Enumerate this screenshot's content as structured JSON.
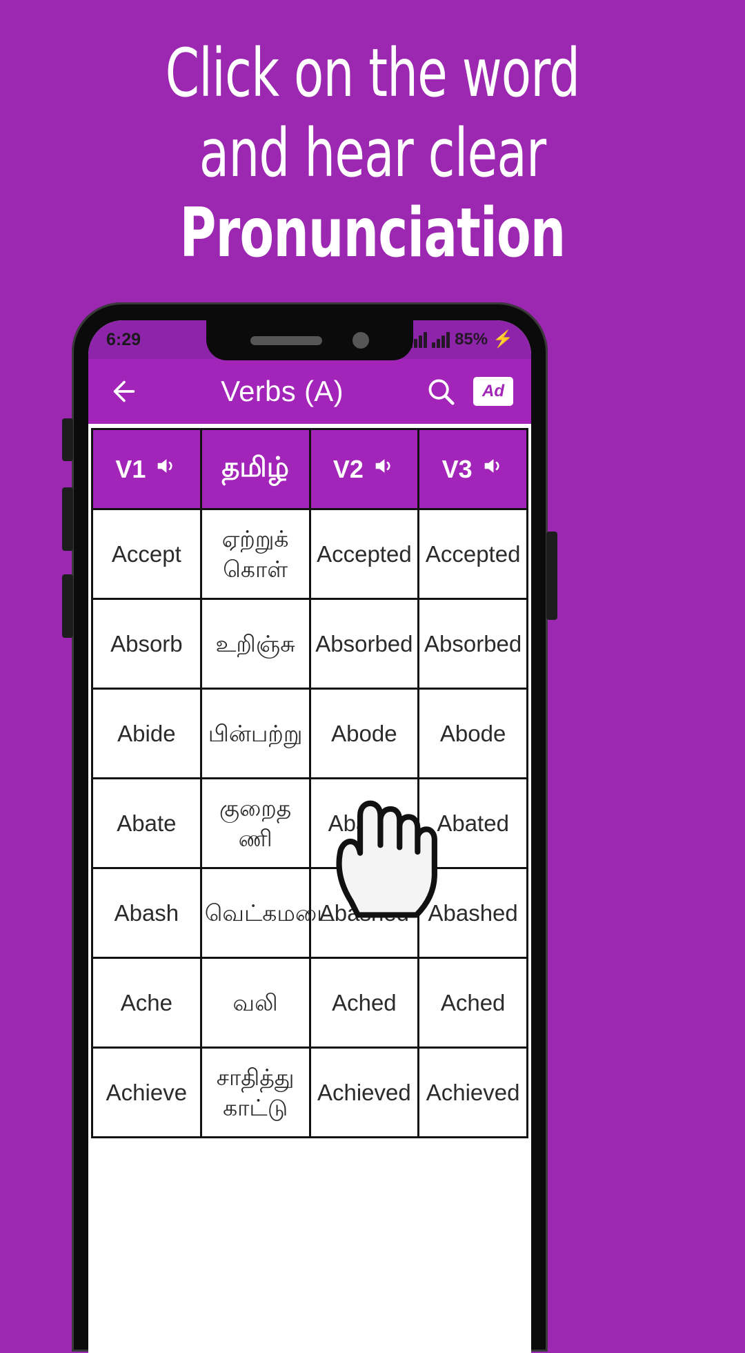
{
  "promo": {
    "lines": [
      "Click on the word",
      "and hear clear",
      "Pronunciation"
    ],
    "background_color": "#9C27B0",
    "text_color": "#FFFFFF"
  },
  "phone": {
    "status_bar": {
      "time": "6:29",
      "battery_percent": "85%",
      "charging_icon": "⚡",
      "signal_icon": "signal-bars"
    },
    "toolbar": {
      "back_icon": "arrow-left-icon",
      "title": "Verbs (A)",
      "search_icon": "search-icon",
      "ad_label": "Ad",
      "accent_color": "#A224B8"
    },
    "table": {
      "headers": [
        {
          "label": "V1",
          "speaker": true
        },
        {
          "label": "தமிழ்",
          "speaker": false
        },
        {
          "label": "V2",
          "speaker": true
        },
        {
          "label": "V3",
          "speaker": true
        }
      ],
      "rows": [
        {
          "v1": "Accept",
          "ta": "ஏற்றுக் கொள்",
          "v2": "Accepted",
          "v3": "Accepted"
        },
        {
          "v1": "Absorb",
          "ta": "உறிஞ்சு",
          "v2": "Absorbed",
          "v3": "Absorbed"
        },
        {
          "v1": "Abide",
          "ta": "பின்பற்று",
          "v2": "Abode",
          "v3": "Abode"
        },
        {
          "v1": "Abate",
          "ta": "குறைத ணி",
          "v2": "Abated",
          "v3": "Abated"
        },
        {
          "v1": "Abash",
          "ta": "வெட்கமடை",
          "v2": "Abashed",
          "v3": "Abashed"
        },
        {
          "v1": "Ache",
          "ta": "வலி",
          "v2": "Ached",
          "v3": "Ached"
        },
        {
          "v1": "Achieve",
          "ta": "சாதித்து காட்டு",
          "v2": "Achieved",
          "v3": "Achieved"
        }
      ]
    },
    "cursor_icon": "pointing-hand-cursor"
  }
}
